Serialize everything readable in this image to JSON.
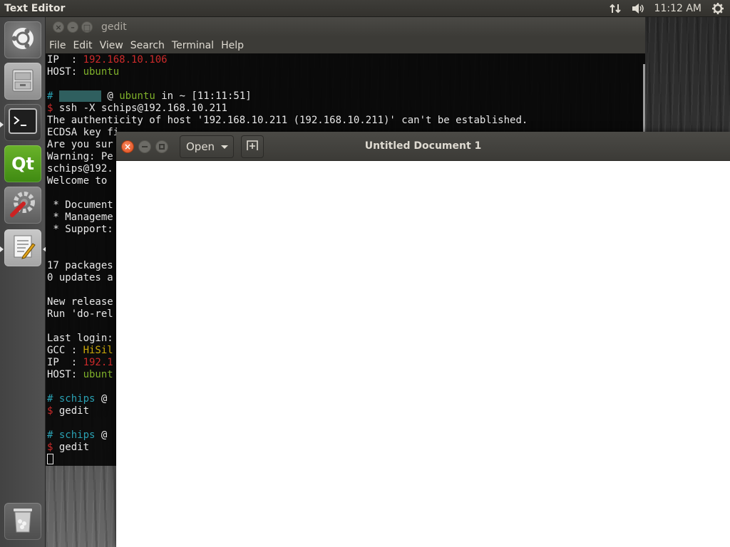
{
  "top_panel": {
    "title": "Text Editor",
    "clock": "11:12 AM",
    "icons": [
      "network-icon",
      "volume-icon",
      "settings-gear-icon"
    ]
  },
  "launcher": {
    "items": [
      {
        "name": "ubuntu-dash",
        "icon": "ubuntu-logo-icon"
      },
      {
        "name": "files",
        "icon": "file-cabinet-icon"
      },
      {
        "name": "terminal",
        "icon": "terminal-icon"
      },
      {
        "name": "qt-creator",
        "icon": "qt-logo-icon",
        "label": "Qt"
      },
      {
        "name": "system-settings",
        "icon": "wrench-gear-icon"
      },
      {
        "name": "text-editor",
        "icon": "text-editor-icon"
      },
      {
        "name": "trash",
        "icon": "trash-icon"
      }
    ]
  },
  "terminal": {
    "title": "gedit",
    "menu": [
      "File",
      "Edit",
      "View",
      "Search",
      "Terminal",
      "Help"
    ],
    "lines": [
      {
        "label": "IP  : ",
        "value": "192.168.10.106"
      },
      {
        "label": "HOST: ",
        "value": "ubuntu"
      },
      {
        "prompt_time": "[11:11:51]",
        "prompt_host": "ubuntu",
        "prompt_dir": "~"
      },
      {
        "cmd": "ssh -X schips@192.168.10.211"
      },
      {
        "text": "The authenticity of host '192.168.10.211 (192.168.10.211)' can't be established."
      },
      {
        "text": "ECDSA key fi"
      },
      {
        "text": "Are you sur"
      },
      {
        "text": "Warning: Pe"
      },
      {
        "text": "schips@192."
      },
      {
        "text": "Welcome to "
      },
      {
        "text": " * Document"
      },
      {
        "text": " * Manageme"
      },
      {
        "text": " * Support:"
      },
      {
        "text": "17 packages"
      },
      {
        "text": "0 updates a"
      },
      {
        "text": "New release"
      },
      {
        "text": "Run 'do-rel"
      },
      {
        "text": "Last login:"
      },
      {
        "label": "GCC : ",
        "value": "HiSil"
      },
      {
        "label": "IP  : ",
        "value": "192.1"
      },
      {
        "label": "HOST: ",
        "value": "ubunt"
      },
      {
        "prompt_user": "schips",
        "prompt_at": "@"
      },
      {
        "cmd": "gedit"
      }
    ]
  },
  "gedit": {
    "title": "Untitled Document 1",
    "open_label": "Open",
    "content": ""
  }
}
